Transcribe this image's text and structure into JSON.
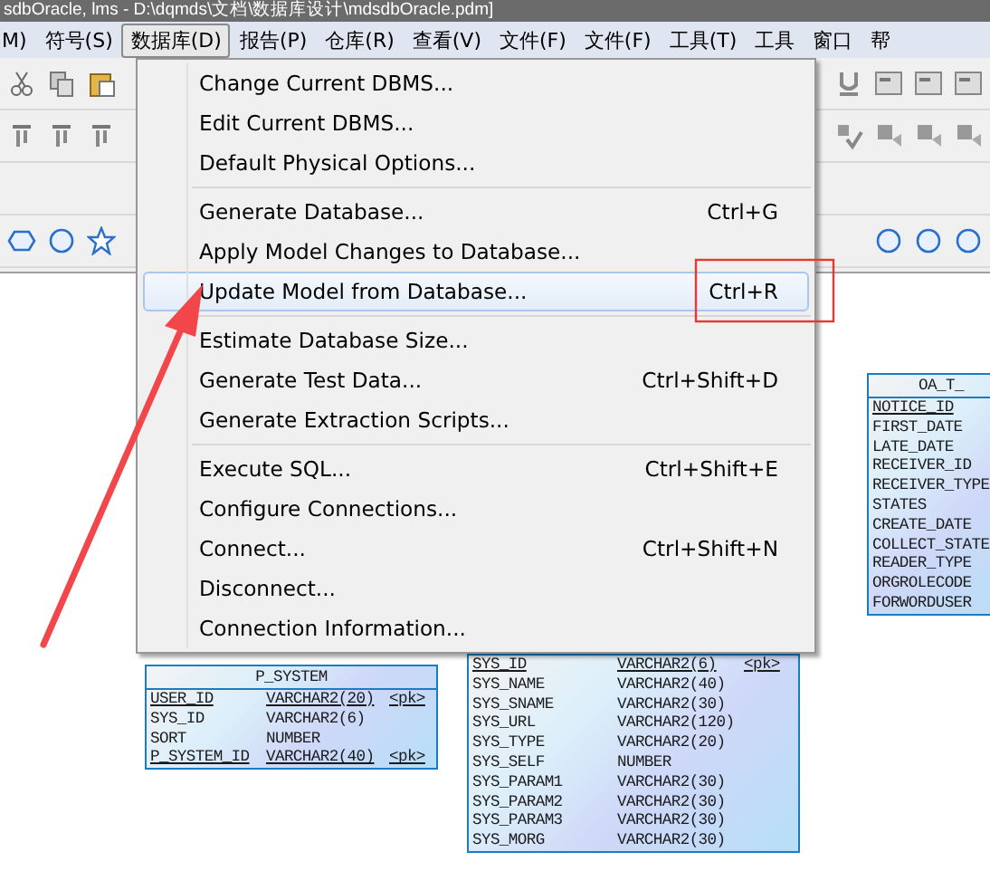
{
  "window": {
    "title": "sdbOracle, lms - D:\\dqmds\\文档\\数据库设计\\mdsdbOracle.pdm]"
  },
  "menubar": [
    {
      "label": "M)",
      "selected": false
    },
    {
      "label": "符号(S)",
      "selected": false
    },
    {
      "label": "数据库(D)",
      "selected": true
    },
    {
      "label": "报告(P)",
      "selected": false
    },
    {
      "label": "仓库(R)",
      "selected": false
    },
    {
      "label": "查看(V)",
      "selected": false
    },
    {
      "label": "文件(F)",
      "selected": false
    },
    {
      "label": "文件(F)",
      "selected": false
    },
    {
      "label": "工具(T)",
      "selected": false
    },
    {
      "label": "工具",
      "selected": false
    },
    {
      "label": "窗口",
      "selected": false
    },
    {
      "label": "帮",
      "selected": false
    }
  ],
  "menu": {
    "groups": [
      [
        {
          "label": "Change Current DBMS...",
          "selected": false
        },
        {
          "label": "Edit Current DBMS...",
          "selected": false
        },
        {
          "label": "Default Physical Options...",
          "selected": false
        }
      ],
      [
        {
          "label": "Generate Database...",
          "shortcut": "Ctrl+G",
          "selected": false
        },
        {
          "label": "Apply Model Changes to Database...",
          "selected": false
        },
        {
          "label": "Update Model from Database...",
          "shortcut": "Ctrl+R",
          "selected": true
        }
      ],
      [
        {
          "label": "Estimate Database Size...",
          "selected": false
        },
        {
          "label": "Generate Test Data...",
          "shortcut": "Ctrl+Shift+D",
          "selected": false
        },
        {
          "label": "Generate Extraction Scripts...",
          "selected": false
        }
      ],
      [
        {
          "label": "Execute SQL...",
          "shortcut": "Ctrl+Shift+E",
          "selected": false
        },
        {
          "label": "Configure Connections...",
          "selected": false
        },
        {
          "label": "Connect...",
          "shortcut": "Ctrl+Shift+N",
          "selected": false
        },
        {
          "label": "Disconnect...",
          "selected": false
        },
        {
          "label": "Connection Information...",
          "selected": false
        }
      ]
    ]
  },
  "tables": [
    {
      "title": "P_SYSTEM",
      "columns": [
        {
          "name": "USER_ID",
          "type": "VARCHAR2(20)",
          "key": "<pk>",
          "primary": true
        },
        {
          "name": "SYS_ID",
          "type": "VARCHAR2(6)",
          "primary": false
        },
        {
          "name": "SORT",
          "type": "NUMBER",
          "primary": false
        },
        {
          "name": "P_SYSTEM_ID",
          "type": "VARCHAR2(40)",
          "key": "<pk>",
          "primary": true
        }
      ]
    },
    {
      "columns": [
        {
          "name": "SYS_ID",
          "type": "VARCHAR2(6)",
          "key": "<pk>",
          "primary": true
        },
        {
          "name": "SYS_NAME",
          "type": "VARCHAR2(40)",
          "primary": false
        },
        {
          "name": "SYS_SNAME",
          "type": "VARCHAR2(30)",
          "primary": false
        },
        {
          "name": "SYS_URL",
          "type": "VARCHAR2(120)",
          "primary": false
        },
        {
          "name": "SYS_TYPE",
          "type": "VARCHAR2(20)",
          "primary": false
        },
        {
          "name": "SYS_SELF",
          "type": "NUMBER",
          "primary": false
        },
        {
          "name": "SYS_PARAM1",
          "type": "VARCHAR2(30)",
          "primary": false
        },
        {
          "name": "SYS_PARAM2",
          "type": "VARCHAR2(30)",
          "primary": false
        },
        {
          "name": "SYS_PARAM3",
          "type": "VARCHAR2(30)",
          "primary": false
        },
        {
          "name": "SYS_MORG",
          "type": "VARCHAR2(30)",
          "primary": false
        }
      ]
    },
    {
      "title": "OA_T_",
      "columns": [
        {
          "name": "NOTICE_ID",
          "primary": true
        },
        {
          "name": "FIRST_DATE",
          "primary": false
        },
        {
          "name": "LATE_DATE",
          "primary": false
        },
        {
          "name": "RECEIVER_ID",
          "primary": false
        },
        {
          "name": "RECEIVER_TYPE",
          "primary": false
        },
        {
          "name": "STATES",
          "primary": false
        },
        {
          "name": "CREATE_DATE",
          "primary": false
        },
        {
          "name": "COLLECT_STATE",
          "primary": false
        },
        {
          "name": "READER_TYPE",
          "primary": false
        },
        {
          "name": "ORGROLECODE",
          "primary": false
        },
        {
          "name": "FORWORDUSER",
          "primary": false
        }
      ]
    }
  ]
}
